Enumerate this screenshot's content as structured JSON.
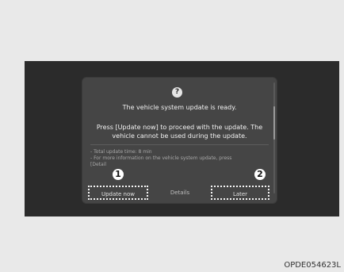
{
  "dialog": {
    "icon": "question-icon",
    "icon_glyph": "?",
    "title": "The vehicle system update is ready.",
    "body_lines": [
      "Press [Update now] to proceed with the update. The",
      "vehicle cannot be used during the update."
    ],
    "notes": [
      "- Total update time: 8 min",
      "- For more information on the vehicle system update, press",
      "[Detail"
    ],
    "buttons": {
      "update_now": "Update now",
      "details": "Details",
      "later": "Later"
    }
  },
  "callouts": [
    "1",
    "2"
  ],
  "figure_code": "OPDE054623L",
  "colors": {
    "background": "#e9e9e9",
    "screen": "#2b2b2b",
    "dialog": "#454545",
    "text": "#f2f2f2",
    "muted_text": "#a8a8a8",
    "highlight_border": "#f5f5f5"
  }
}
